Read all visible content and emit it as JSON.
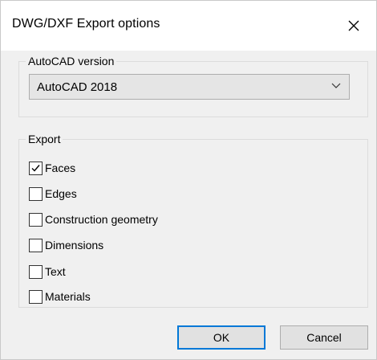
{
  "dialog": {
    "title": "DWG/DXF Export options"
  },
  "version_group": {
    "label": "AutoCAD version",
    "selected": "AutoCAD 2018"
  },
  "export_group": {
    "label": "Export",
    "options": [
      {
        "label": "Faces",
        "checked": true
      },
      {
        "label": "Edges",
        "checked": false
      },
      {
        "label": "Construction geometry",
        "checked": false
      },
      {
        "label": "Dimensions",
        "checked": false
      },
      {
        "label": "Text",
        "checked": false
      },
      {
        "label": "Materials",
        "checked": false
      }
    ]
  },
  "buttons": {
    "ok_label": "OK",
    "cancel_label": "Cancel"
  },
  "colors": {
    "accent": "#0078d7",
    "background": "#f0f0f0"
  }
}
